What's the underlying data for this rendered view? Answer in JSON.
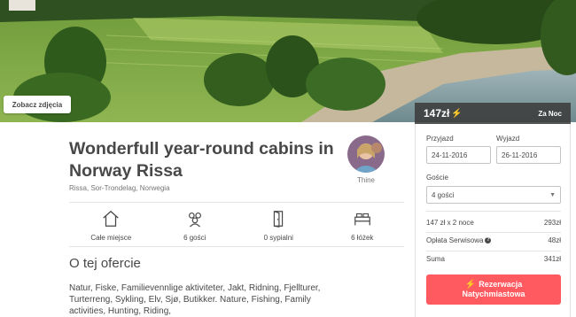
{
  "hero": {
    "photos_button": "Zobacz zdjęcia"
  },
  "listing": {
    "title": "Wonderfull year-round cabins in Norway Rissa",
    "location": "Rissa, Sor-Trondelag, Norwegia",
    "host_name": "Thine",
    "amenities": [
      {
        "icon": "home-icon",
        "label": "Całe miejsce"
      },
      {
        "icon": "guests-icon",
        "label": "6 gości"
      },
      {
        "icon": "door-icon",
        "label": "0 sypialni"
      },
      {
        "icon": "bed-icon",
        "label": "6 łóżek"
      }
    ],
    "section_title": "O tej ofercie",
    "description": "Natur, Fiske, Familievennlige aktiviteter, Jakt, Ridning, Fjellturer, Turterreng, Sykling, Elv, Sjø, Butikker. Nature, Fishing, Family activities, Hunting, Riding,"
  },
  "booking": {
    "price": "147zł",
    "per_night": "Za Noc",
    "checkin_label": "Przyjazd",
    "checkin_value": "24-11-2016",
    "checkout_label": "Wyjazd",
    "checkout_value": "26-11-2016",
    "guests_label": "Goście",
    "guests_value": "4 gości",
    "nights_label": "147 zł x 2 noce",
    "nights_value": "293zł",
    "service_label": "Opłata Serwisowa",
    "service_value": "48zł",
    "total_label": "Suma",
    "total_value": "341zł",
    "book_line1": "Rezerwacja",
    "book_line2": "Natychmiastowa"
  },
  "colors": {
    "accent": "#FF5A5F",
    "bolt": "#FFB400",
    "text": "#484848"
  }
}
